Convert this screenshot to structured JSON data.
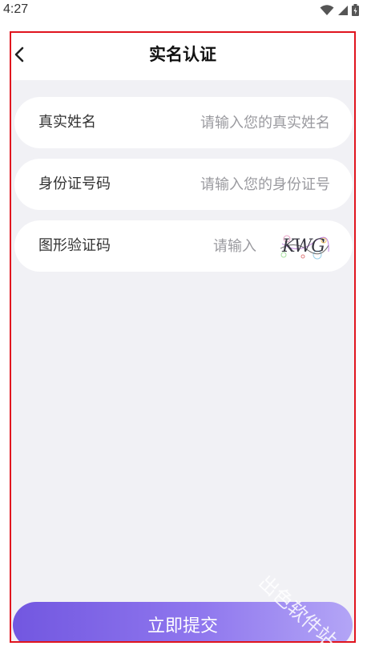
{
  "status_bar": {
    "time": "4:27"
  },
  "header": {
    "title": "实名认证"
  },
  "form": {
    "real_name": {
      "label": "真实姓名",
      "placeholder": "请输入您的真实姓名",
      "value": ""
    },
    "id_number": {
      "label": "身份证号码",
      "placeholder": "请输入您的身份证号",
      "value": ""
    },
    "captcha": {
      "label": "图形验证码",
      "placeholder": "请输入",
      "value": "",
      "image_text": "KWG"
    }
  },
  "submit": {
    "label": "立即提交"
  },
  "colors": {
    "accent_start": "#7257e0",
    "accent_end": "#b3a5f6",
    "frame": "#e0141e",
    "background": "#f1f1f5"
  },
  "watermark": {
    "text": "出色软件站"
  }
}
